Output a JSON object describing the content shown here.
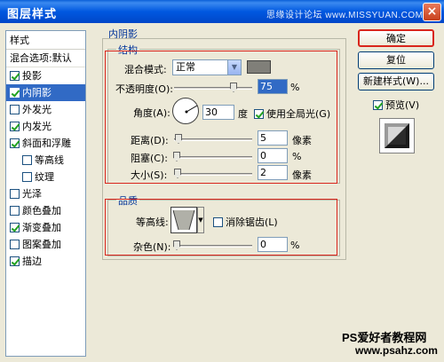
{
  "window": {
    "title": "图层样式",
    "watermark": "思缘设计论坛 www.MISSYUAN.COM",
    "close": "×"
  },
  "styles_panel": {
    "header": "样式",
    "blending": "混合选项:默认",
    "items": [
      {
        "label": "投影",
        "checked": true,
        "indent": false,
        "selected": false
      },
      {
        "label": "内阴影",
        "checked": true,
        "indent": false,
        "selected": true
      },
      {
        "label": "外发光",
        "checked": false,
        "indent": false,
        "selected": false
      },
      {
        "label": "内发光",
        "checked": true,
        "indent": false,
        "selected": false
      },
      {
        "label": "斜面和浮雕",
        "checked": true,
        "indent": false,
        "selected": false
      },
      {
        "label": "等高线",
        "checked": false,
        "indent": true,
        "selected": false
      },
      {
        "label": "纹理",
        "checked": false,
        "indent": true,
        "selected": false
      },
      {
        "label": "光泽",
        "checked": false,
        "indent": false,
        "selected": false
      },
      {
        "label": "颜色叠加",
        "checked": false,
        "indent": false,
        "selected": false
      },
      {
        "label": "渐变叠加",
        "checked": true,
        "indent": false,
        "selected": false
      },
      {
        "label": "图案叠加",
        "checked": false,
        "indent": false,
        "selected": false
      },
      {
        "label": "描边",
        "checked": true,
        "indent": false,
        "selected": false
      }
    ]
  },
  "inner_shadow": {
    "title": "内阴影",
    "structure": {
      "title": "结构",
      "blend_mode_label": "混合模式:",
      "blend_mode_value": "正常",
      "color": "#807f79",
      "opacity_label": "不透明度(O):",
      "opacity_value": "75",
      "opacity_unit": "%",
      "angle_label": "角度(A):",
      "angle_value": "30",
      "angle_unit": "度",
      "global_light_label": "使用全局光(G)",
      "global_light_checked": true,
      "distance_label": "距离(D):",
      "distance_value": "5",
      "distance_unit": "像素",
      "choke_label": "阻塞(C):",
      "choke_value": "0",
      "choke_unit": "%",
      "size_label": "大小(S):",
      "size_value": "2",
      "size_unit": "像素"
    },
    "quality": {
      "title": "品质",
      "contour_label": "等高线:",
      "antialias_label": "消除锯齿(L)",
      "antialias_checked": false,
      "noise_label": "杂色(N):",
      "noise_value": "0",
      "noise_unit": "%"
    }
  },
  "buttons": {
    "ok": "确定",
    "reset": "复位",
    "new_style": "新建样式(W)...",
    "preview_label": "预览(V)",
    "preview_checked": true
  },
  "footer": {
    "brand": "PS爱好者教程网",
    "url": "www.psahz.com"
  },
  "colors": {
    "accent_red": "#d9251c",
    "selection": "#316ac5",
    "group_title": "#003399"
  }
}
